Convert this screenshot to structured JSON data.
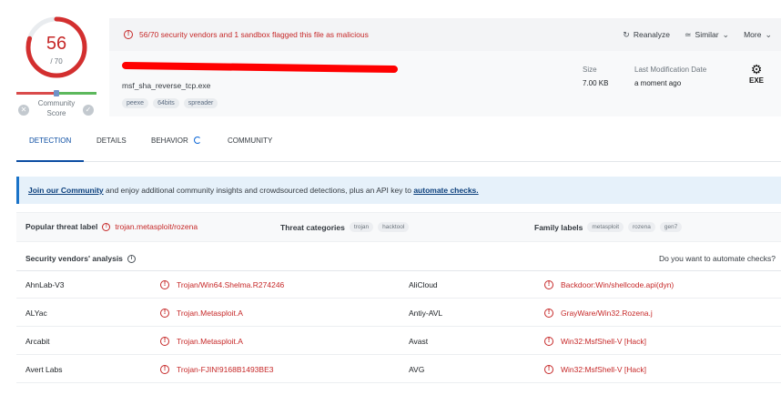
{
  "score": {
    "detections": "56",
    "total": "/ 70",
    "ratio": 0.8,
    "community_label": "Community Score",
    "community_label_1": "Community",
    "community_label_2": "Score"
  },
  "alert": {
    "text": "56/70 security vendors and 1 sandbox flagged this file as malicious",
    "actions": [
      {
        "label": "Reanalyze",
        "icon": "refresh-icon"
      },
      {
        "label": "Similar",
        "icon": "similar-icon"
      },
      {
        "label": "More",
        "icon": "chevron-down-icon"
      }
    ]
  },
  "file": {
    "name": "msf_sha_reverse_tcp.exe",
    "tags": [
      "peexe",
      "64bits",
      "spreader"
    ],
    "size_label": "Size",
    "size_value": "7.00 KB",
    "modified_label": "Last Modification Date",
    "modified_value": "a moment ago",
    "type_label": "EXE"
  },
  "tabs": [
    {
      "label": "DETECTION",
      "active": true
    },
    {
      "label": "DETAILS",
      "active": false
    },
    {
      "label": "BEHAVIOR",
      "active": false
    },
    {
      "label": "COMMUNITY",
      "active": false
    }
  ],
  "banner": {
    "link1": "Join our Community",
    "middle": " and enjoy additional community insights and crowdsourced detections, plus an API key to ",
    "link2": "automate checks."
  },
  "labels": {
    "popular_title": "Popular threat label",
    "popular_value": "trojan.metasploit/rozena",
    "categories_title": "Threat categories",
    "categories": [
      "trojan",
      "hacktool"
    ],
    "family_title": "Family labels",
    "families": [
      "metasploit",
      "rozena",
      "gen7"
    ]
  },
  "analysis": {
    "title": "Security vendors' analysis",
    "automate_question": "Do you want to automate checks?"
  },
  "vendors": [
    {
      "left_vendor": "AhnLab-V3",
      "left_result": "Trojan/Win64.Shelma.R274246",
      "right_vendor": "AliCloud",
      "right_result": "Backdoor:Win/shellcode.api(dyn)"
    },
    {
      "left_vendor": "ALYac",
      "left_result": "Trojan.Metasploit.A",
      "right_vendor": "Antiy-AVL",
      "right_result": "GrayWare/Win32.Rozena.j"
    },
    {
      "left_vendor": "Arcabit",
      "left_result": "Trojan.Metasploit.A",
      "right_vendor": "Avast",
      "right_result": "Win32:MsfShell-V [Hack]"
    },
    {
      "left_vendor": "Avert Labs",
      "left_result": "Trojan-FJIN!9168B1493BE3",
      "right_vendor": "AVG",
      "right_result": "Win32:MsfShell-V [Hack]"
    }
  ],
  "colors": {
    "malicious": "#c62828",
    "accent": "#0b4da2",
    "banner_bg": "#e6f1fa"
  }
}
